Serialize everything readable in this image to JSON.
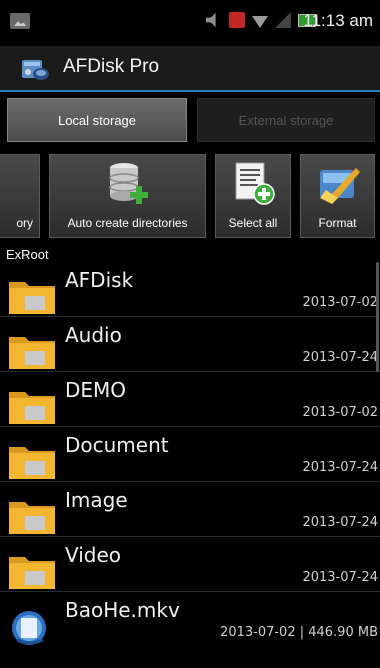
{
  "status_bar": {
    "time": "11:13 am",
    "icons": [
      "image-notification-icon",
      "mute-icon",
      "alert-icon",
      "wifi-icon",
      "signal-icon",
      "battery-icon"
    ]
  },
  "app": {
    "title": "AFDisk Pro",
    "icon": "afdisk-app-icon",
    "accent_color": "#2a7fb8"
  },
  "tabs": [
    {
      "label": "Local storage",
      "selected": true
    },
    {
      "label": "External storage",
      "selected": false
    }
  ],
  "toolbar": [
    {
      "label": "ory",
      "icon": "directory-icon"
    },
    {
      "label": "Auto create directories",
      "icon": "database-add-icon"
    },
    {
      "label": "Select all",
      "icon": "document-add-icon"
    },
    {
      "label": "Format",
      "icon": "format-broom-icon"
    }
  ],
  "path": "ExRoot",
  "files": [
    {
      "name": "AFDisk",
      "meta": "2013-07-02",
      "type": "folder"
    },
    {
      "name": "Audio",
      "meta": "2013-07-24",
      "type": "folder"
    },
    {
      "name": "DEMO",
      "meta": "2013-07-02",
      "type": "folder"
    },
    {
      "name": "Document",
      "meta": "2013-07-24",
      "type": "folder"
    },
    {
      "name": "Image",
      "meta": "2013-07-24",
      "type": "folder"
    },
    {
      "name": "Video",
      "meta": "2013-07-24",
      "type": "folder"
    },
    {
      "name": "BaoHe.mkv",
      "meta": "2013-07-02 | 446.90 MB",
      "type": "video"
    }
  ]
}
